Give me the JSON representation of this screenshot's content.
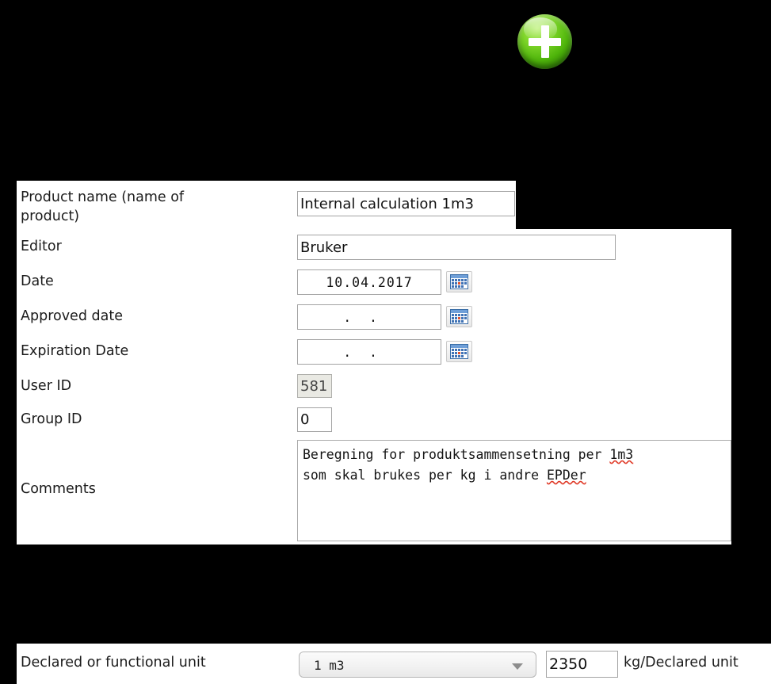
{
  "toolbar": {
    "add_button_label": "+",
    "add_button_icon": "plus-circle-icon",
    "add_button_color": "#5cb80c"
  },
  "form": {
    "fields": [
      {
        "label": "Product name (name of\nproduct)",
        "value": "Internal calculation 1m3",
        "type": "text"
      },
      {
        "label": "Editor",
        "value": "Bruker",
        "type": "text"
      },
      {
        "label": "Date",
        "value": "10.04.2017",
        "type": "date",
        "icon": "calendar-icon"
      },
      {
        "label": "Approved date",
        "value": "  .  .    ",
        "type": "date",
        "icon": "calendar-icon"
      },
      {
        "label": "Expiration Date",
        "value": "  .  .    ",
        "type": "date",
        "icon": "calendar-icon"
      },
      {
        "label": "User ID",
        "value": "581",
        "type": "text",
        "disabled": true
      },
      {
        "label": "Group ID",
        "value": "0",
        "type": "text"
      },
      {
        "label": "Comments",
        "type": "textarea"
      }
    ],
    "comments": {
      "label": "Comments",
      "line1_a": "Beregning for produktsammensetning per ",
      "line1_b": "1m3",
      "line2_a": "som skal brukes per kg i andre ",
      "line2_b": "EPDer"
    }
  },
  "unit_row": {
    "label": "Declared or functional unit",
    "selected_unit": "1 m3",
    "quantity": "2350",
    "suffix": "kg/Declared unit",
    "caret_icon": "chevron-down-icon"
  }
}
